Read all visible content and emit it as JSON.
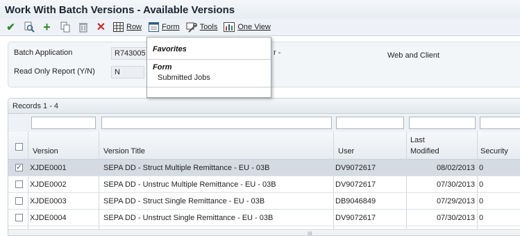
{
  "window": {
    "title": "Work With Batch Versions - Available Versions"
  },
  "toolbar": {
    "icons": [
      "select-icon",
      "find-icon",
      "add-icon",
      "copy-icon",
      "delete-icon",
      "close-icon"
    ],
    "row_label": "Row",
    "form_label": "Form",
    "tools_label": "Tools",
    "one_view_label": "One View"
  },
  "header": {
    "batch_application_label": "Batch Application",
    "batch_application_value": "R743005",
    "read_only_label": "Read Only Report (Y/N)",
    "read_only_value": "N",
    "partial_label": "r -",
    "web_client_text": "Web and Client"
  },
  "form_menu": {
    "favorites_heading": "Favorites",
    "form_heading": "Form",
    "items": [
      "Submitted Jobs"
    ]
  },
  "grid": {
    "records_label": "Records 1 - 4",
    "columns": {
      "version": "Version",
      "version_title": "Version Title",
      "user": "User",
      "last_modified_line1": "Last",
      "last_modified_line2": "Modified",
      "security": "Security"
    },
    "rows": [
      {
        "version": "XJDE0001",
        "title": "SEPA DD - Struct Multiple Remittance - EU - 03B",
        "user": "DV9072617",
        "modified": "08/02/2013",
        "security": "0",
        "checked": true
      },
      {
        "version": "XJDE0002",
        "title": "SEPA DD - Unstruc Multiple Remittance - EU - 03B",
        "user": "DV9072617",
        "modified": "07/30/2013",
        "security": "0",
        "checked": false
      },
      {
        "version": "XJDE0003",
        "title": "SEPA DD - Struct Single Remittance - EU - 03B",
        "user": "DB9046849",
        "modified": "07/29/2013",
        "security": "0",
        "checked": false
      },
      {
        "version": "XJDE0004",
        "title": "SEPA DD - Unstruct Single Remittance - EU - 03B",
        "user": "DV9072617",
        "modified": "07/30/2013",
        "security": "0",
        "checked": false
      }
    ],
    "checkmark_glyph": "✓",
    "scroll_grip": "|||"
  }
}
